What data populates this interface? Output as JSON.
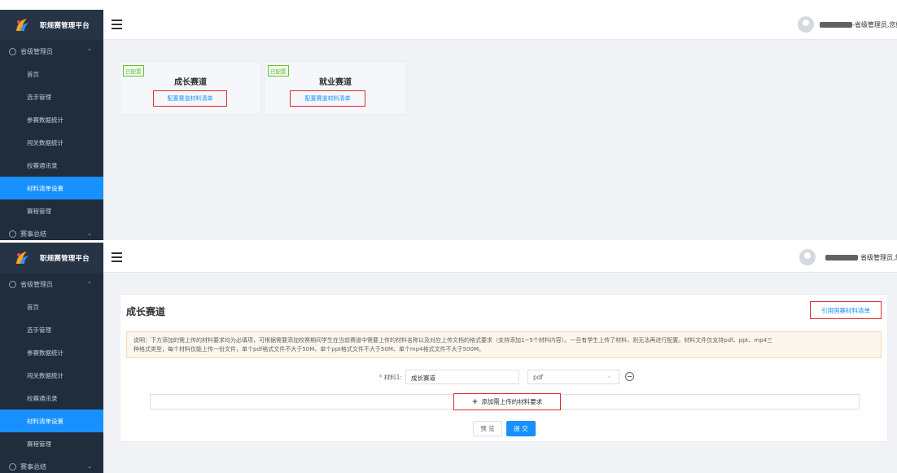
{
  "app": {
    "title": "职规赛管理平台"
  },
  "brand_colors": {
    "sidebar": "#1f2d3d",
    "active": "#1890ff",
    "highlight": "#e02c2c",
    "tag": "#67c23a"
  },
  "sidebar": {
    "group_label": "省级管理员",
    "items": [
      {
        "label": "首页"
      },
      {
        "label": "选手管理"
      },
      {
        "label": "参赛数据统计"
      },
      {
        "label": "闯关数据统计"
      },
      {
        "label": "校赛通讯录"
      },
      {
        "label": "材料清单设置"
      },
      {
        "label": "赛程管理"
      }
    ],
    "bottom_group_label": "赛事总结"
  },
  "header": {
    "user_label_1": "-省级管理员,您好",
    "user_label_2": "省级管理员,您好"
  },
  "cards": [
    {
      "tag": "已配置",
      "title": "成长赛道",
      "link": "配置赛道材料清单"
    },
    {
      "tag": "已配置",
      "title": "就业赛道",
      "link": "配置赛道材料清单"
    }
  ],
  "detail": {
    "title": "成长赛道",
    "reference_button": "引用国赛材料清单",
    "notice_line1": "说明：下方添加的需上传的材料要求均为必填项，可根据需要添加校赛期间学生在当前赛道中需要上传的材料名称以及对应上传文档的格式要求（支持添加1~5个材料内容）。一旦有学生上传了材料，则无法再进行配置。材料文件仅支持pdf、ppt、mp4三",
    "notice_line2": "种格式类型，每个材料仅能上传一份文件，单个pdf格式文件不大于50M、单个ppt格式文件不大于50M、单个mp4格式文件不大于500M。",
    "form": {
      "label_required": "*",
      "label": "材料1:",
      "name_value": "成长赛道",
      "format_value": "pdf"
    },
    "add_button": "添加需上传的材料要求",
    "preview_button": "预 览",
    "submit_button": "提 交"
  }
}
